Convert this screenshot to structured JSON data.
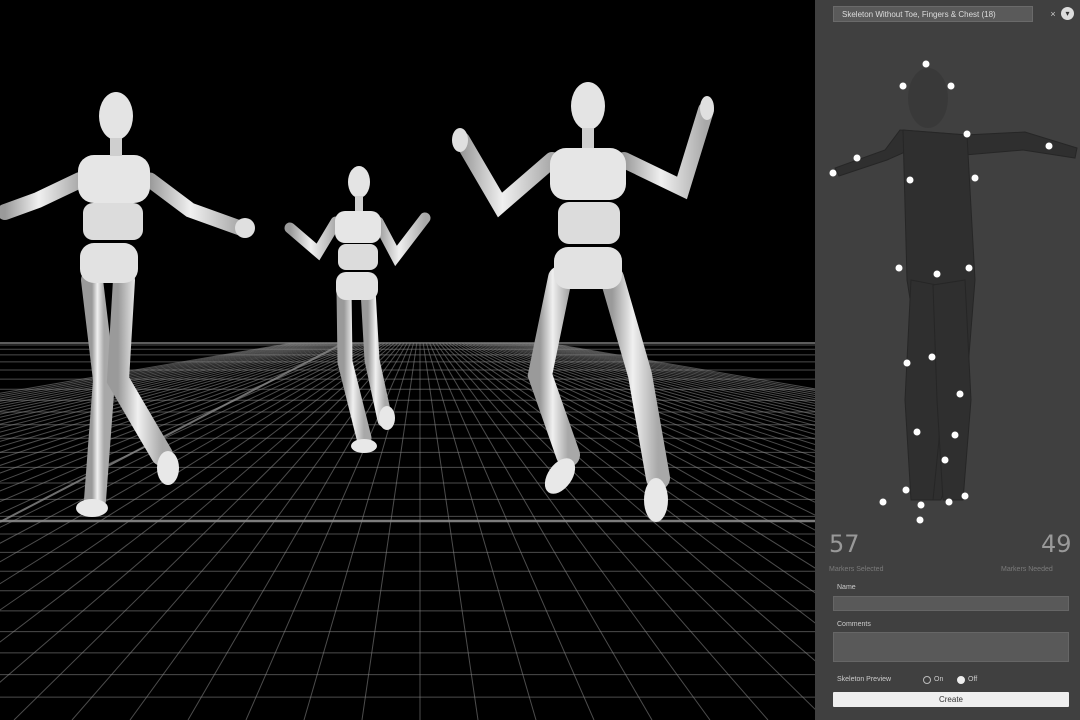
{
  "panel": {
    "preset": {
      "selected": "Skeleton Without Toe, Fingers & Chest (18)",
      "clear_glyph": "×",
      "dropdown_glyph": "▾"
    },
    "stats": {
      "left": {
        "value": "57",
        "label": "Markers Selected"
      },
      "right": {
        "value": "49",
        "label": "Markers Needed"
      }
    },
    "name_field": {
      "label": "Name",
      "value": ""
    },
    "comments_field": {
      "label": "Comments",
      "value": ""
    },
    "skeleton_preview": {
      "label": "Skeleton Preview",
      "on_label": "On",
      "off_label": "Off",
      "selected": "Off"
    },
    "create_button": {
      "label": "Create"
    }
  },
  "colors": {
    "panel_bg": "#404040",
    "viewport_bg": "#000000",
    "grid": "#8a8a8a",
    "figure": "#d8d8d8",
    "marker": "#ffffff"
  },
  "icons": {
    "preset_clear": "close-icon",
    "preset_dropdown": "chevron-down-icon"
  }
}
